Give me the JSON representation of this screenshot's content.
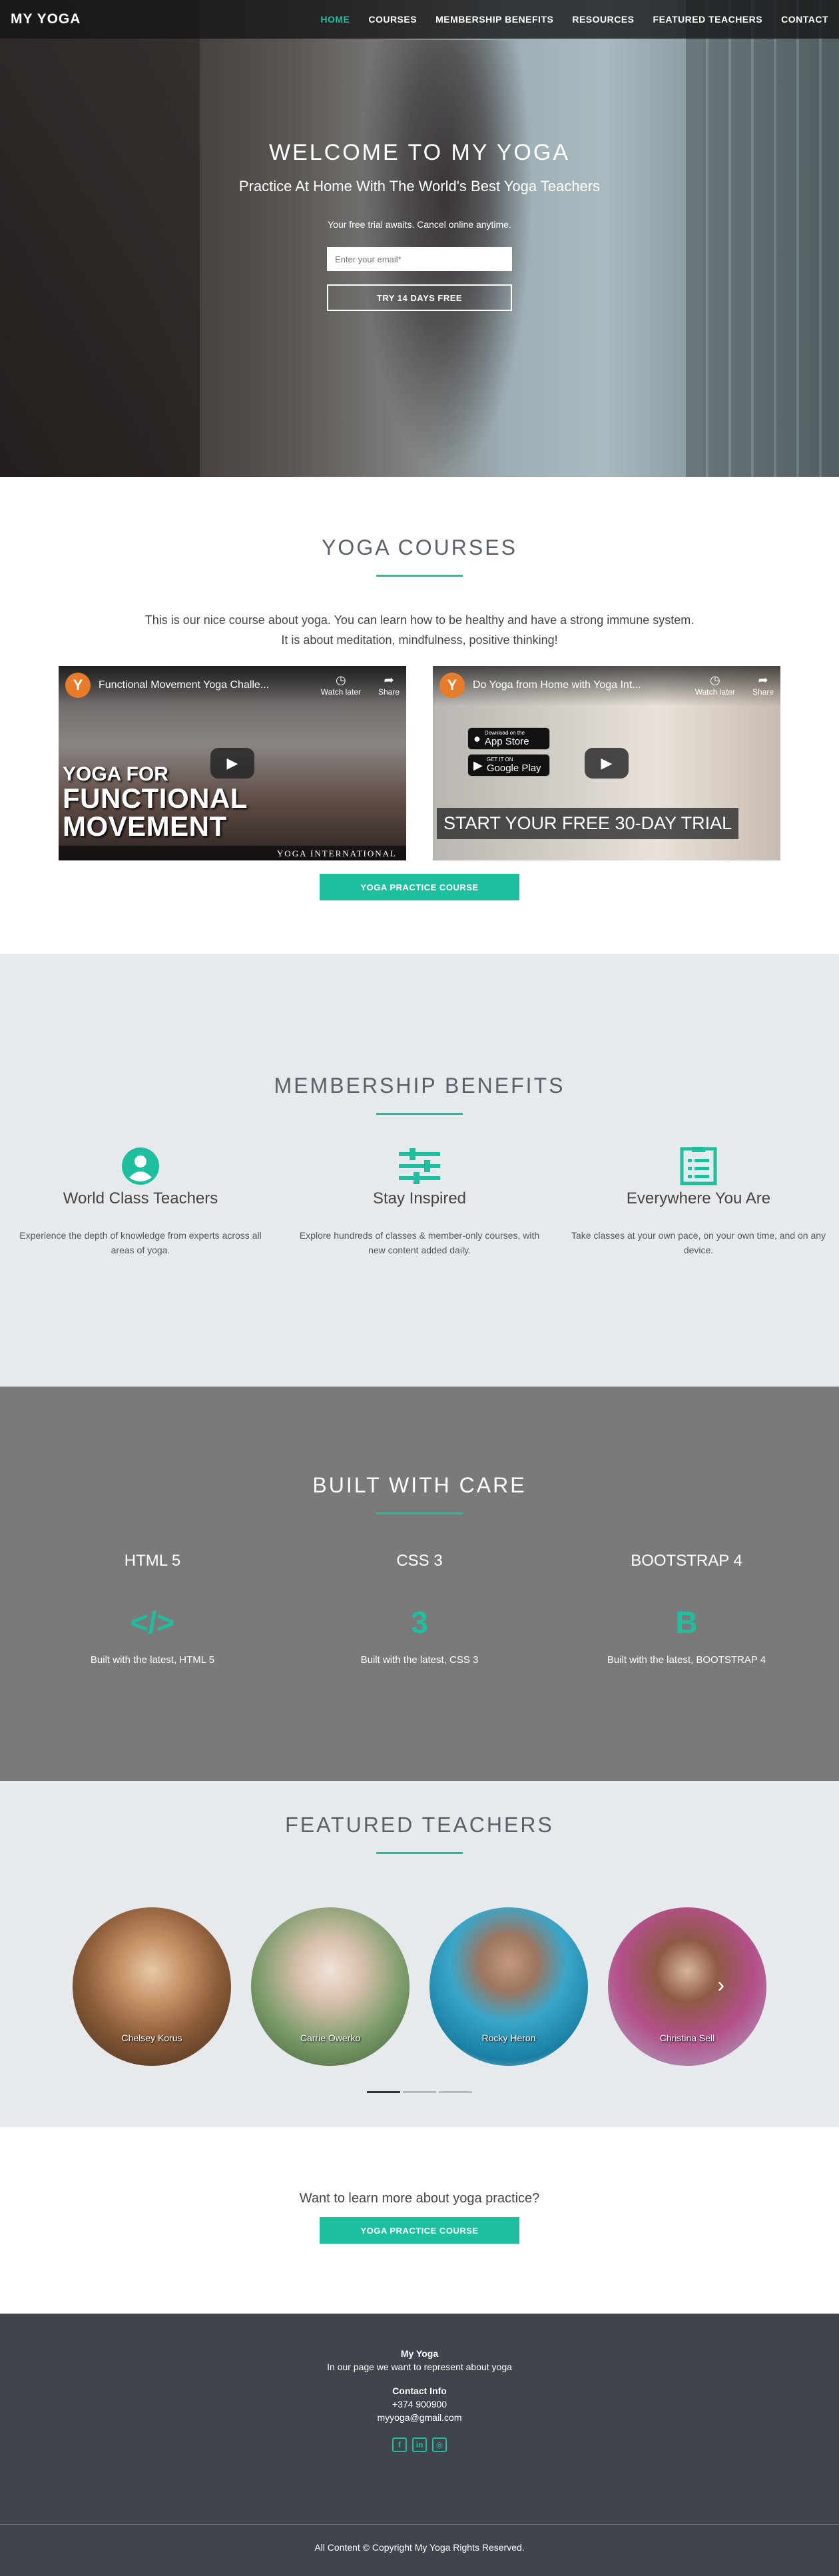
{
  "nav": {
    "brand": "MY YOGA",
    "links": [
      "HOME",
      "COURSES",
      "MEMBERSHIP BENEFITS",
      "RESOURCES",
      "FEATURED TEACHERS",
      "CONTACT"
    ],
    "active": "HOME",
    "accent": "#1dbf9f"
  },
  "hero": {
    "title": "WELCOME TO MY YOGA",
    "subtitle": "Practice At Home With The World's Best Yoga Teachers",
    "note": "Your free trial awaits. Cancel online anytime.",
    "email_placeholder": "Enter your email*",
    "cta": "TRY 14 DAYS FREE"
  },
  "courses": {
    "title": "YOGA COURSES",
    "desc_line1": "This is our nice course about yoga. You can learn how to be healthy and have a strong immune system.",
    "desc_line2": "It is about meditation, mindfulness, positive thinking!",
    "video1": {
      "title": "Functional Movement Yoga Challe...",
      "overlay_line1": "YOGA FOR",
      "overlay_line2": "FUNCTIONAL MOVEMENT",
      "footer": "YOGA INTERNATIONAL"
    },
    "video2": {
      "title": "Do Yoga from Home with Yoga Int...",
      "appstore_small": "Download on the",
      "appstore": "App Store",
      "gplay_small": "GET IT ON",
      "gplay": "Google Play",
      "banner": "START YOUR FREE 30-DAY TRIAL"
    },
    "watch_later": "Watch later",
    "share": "Share",
    "yt_letter": "Y",
    "button": "YOGA PRACTICE COURSE"
  },
  "benefits": {
    "title": "MEMBERSHIP BENEFITS",
    "items": [
      {
        "title": "World Class Teachers",
        "text": "Experience the depth of knowledge from experts across all areas of yoga.",
        "icon": "user-circle-icon"
      },
      {
        "title": "Stay Inspired",
        "text": "Explore hundreds of classes & member-only courses, with new content added daily.",
        "icon": "sliders-icon"
      },
      {
        "title": "Everywhere You Are",
        "text": "Take classes at your own pace, on your own time, and on any device.",
        "icon": "clipboard-list-icon"
      }
    ]
  },
  "built": {
    "title": "BUILT WITH CARE",
    "items": [
      {
        "title": "HTML 5",
        "text": "Built with the latest, HTML 5",
        "icon": "code-icon",
        "glyph": "</>"
      },
      {
        "title": "CSS 3",
        "text": "Built with the latest, CSS 3",
        "icon": "css3-icon",
        "glyph": "3"
      },
      {
        "title": "BOOTSTRAP 4",
        "text": "Built with the latest, BOOTSTRAP 4",
        "icon": "bootstrap-icon",
        "glyph": "B"
      }
    ]
  },
  "teachers": {
    "title": "FEATURED TEACHERS",
    "names": [
      "Chelsey Korus",
      "Carrie Owerko",
      "Rocky Heron",
      "Christina Sell"
    ],
    "next_glyph": "›"
  },
  "learn": {
    "text": "Want to learn more about yoga practice?",
    "button": "YOGA PRACTICE COURSE"
  },
  "footer": {
    "name": "My Yoga",
    "tagline": "In our page we want to represent about yoga",
    "contact_heading": "Contact Info",
    "phone": "+374 900900",
    "email": "myyoga@gmail.com",
    "socials": [
      {
        "icon": "facebook-icon",
        "glyph": "f"
      },
      {
        "icon": "linkedin-icon",
        "glyph": "in"
      },
      {
        "icon": "instagram-icon",
        "glyph": "◎"
      }
    ],
    "copyright": "All Content © Copyright My Yoga Rights Reserved."
  }
}
